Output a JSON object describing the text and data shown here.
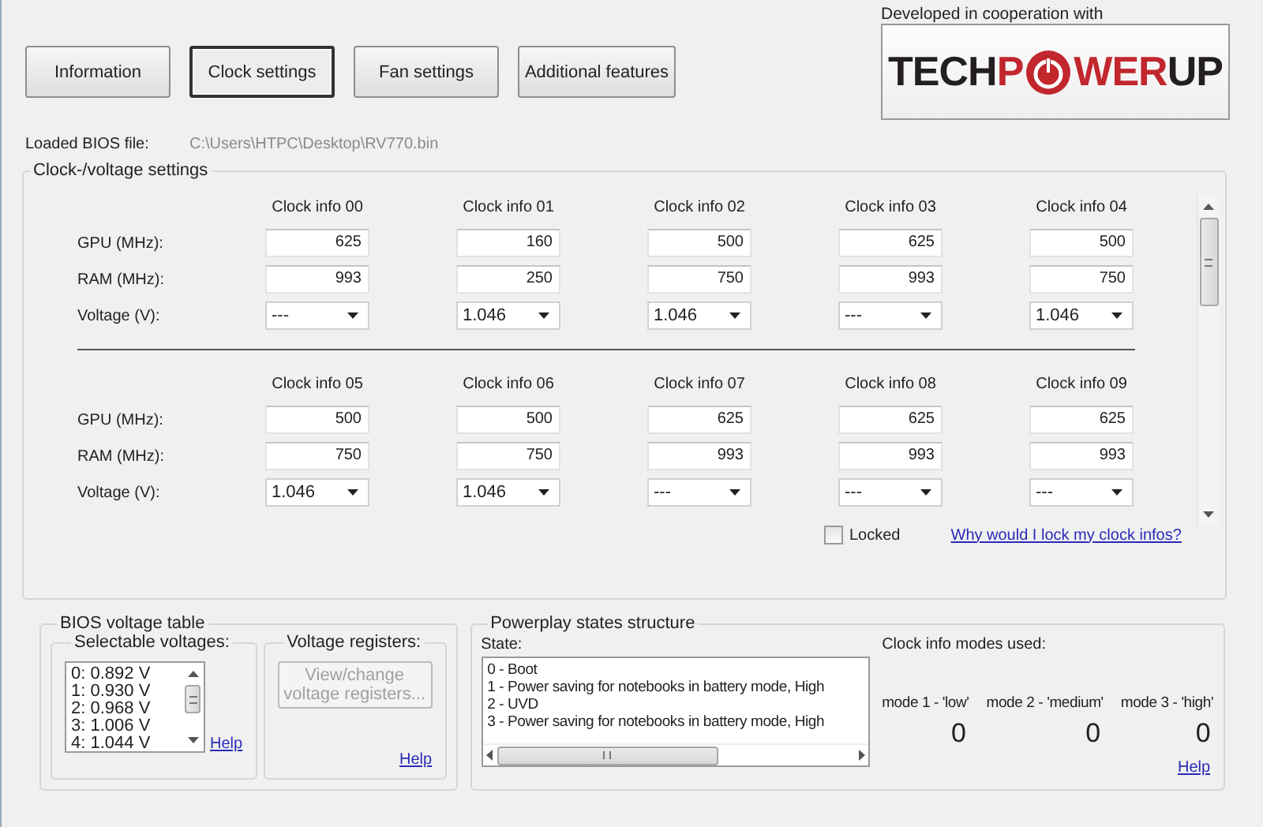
{
  "tabs": [
    {
      "label": "Information",
      "selected": false
    },
    {
      "label": "Clock settings",
      "selected": true
    },
    {
      "label": "Fan settings",
      "selected": false
    },
    {
      "label": "Additional features",
      "selected": false
    }
  ],
  "logo": {
    "caption": "Developed in cooperation with",
    "parts": [
      {
        "kind": "text",
        "text": "TECH",
        "color": "#231f20"
      },
      {
        "kind": "text",
        "text": "P",
        "color": "#c1272d"
      },
      {
        "kind": "power",
        "color": "#c1272d"
      },
      {
        "kind": "text",
        "text": "WER",
        "color": "#c1272d"
      },
      {
        "kind": "text",
        "text": "UP",
        "color": "#231f20"
      }
    ]
  },
  "bios_file": {
    "label": "Loaded BIOS file:",
    "value": "C:\\Users\\HTPC\\Desktop\\RV770.bin"
  },
  "clock_settings": {
    "title": "Clock-/voltage settings",
    "blocks": [
      {
        "row_labels": [
          "GPU (MHz):",
          "RAM (MHz):",
          "Voltage (V):"
        ],
        "columns": [
          {
            "header": "Clock info 00",
            "gpu": "625",
            "ram": "993",
            "voltage": "---"
          },
          {
            "header": "Clock info 01",
            "gpu": "160",
            "ram": "250",
            "voltage": "1.046"
          },
          {
            "header": "Clock info 02",
            "gpu": "500",
            "ram": "750",
            "voltage": "1.046"
          },
          {
            "header": "Clock info 03",
            "gpu": "625",
            "ram": "993",
            "voltage": "---"
          },
          {
            "header": "Clock info 04",
            "gpu": "500",
            "ram": "750",
            "voltage": "1.046"
          }
        ]
      },
      {
        "row_labels": [
          "GPU (MHz):",
          "RAM (MHz):",
          "Voltage (V):"
        ],
        "columns": [
          {
            "header": "Clock info 05",
            "gpu": "500",
            "ram": "750",
            "voltage": "1.046"
          },
          {
            "header": "Clock info 06",
            "gpu": "500",
            "ram": "750",
            "voltage": "1.046"
          },
          {
            "header": "Clock info 07",
            "gpu": "625",
            "ram": "993",
            "voltage": "---"
          },
          {
            "header": "Clock info 08",
            "gpu": "625",
            "ram": "993",
            "voltage": "---"
          },
          {
            "header": "Clock info 09",
            "gpu": "625",
            "ram": "993",
            "voltage": "---"
          }
        ]
      }
    ],
    "locked": {
      "label": "Locked",
      "checked": false
    },
    "link": "Why would I lock my clock infos?"
  },
  "voltage_table": {
    "title": "BIOS voltage table",
    "selectable_title": "Selectable voltages:",
    "voltages": [
      "0: 0.892 V",
      "1: 0.930 V",
      "2: 0.968 V",
      "3: 1.006 V",
      "4: 1.044 V"
    ],
    "selectable_help": "Help",
    "registers_title": "Voltage registers:",
    "registers_button": {
      "label": "View/change voltage registers...",
      "disabled": true
    },
    "registers_help": "Help"
  },
  "powerplay": {
    "title": "Powerplay states structure",
    "state_label": "State:",
    "states": [
      "0 - Boot",
      "1 - Power saving for notebooks in battery mode, High",
      "2 - UVD",
      "3 - Power saving for notebooks in battery mode, High"
    ],
    "modes_title": "Clock info modes used:",
    "modes": [
      {
        "label": "mode 1 - 'low'",
        "value": "0"
      },
      {
        "label": "mode 2 - 'medium'",
        "value": "0"
      },
      {
        "label": "mode 3 - 'high'",
        "value": "0"
      }
    ],
    "help": "Help"
  }
}
